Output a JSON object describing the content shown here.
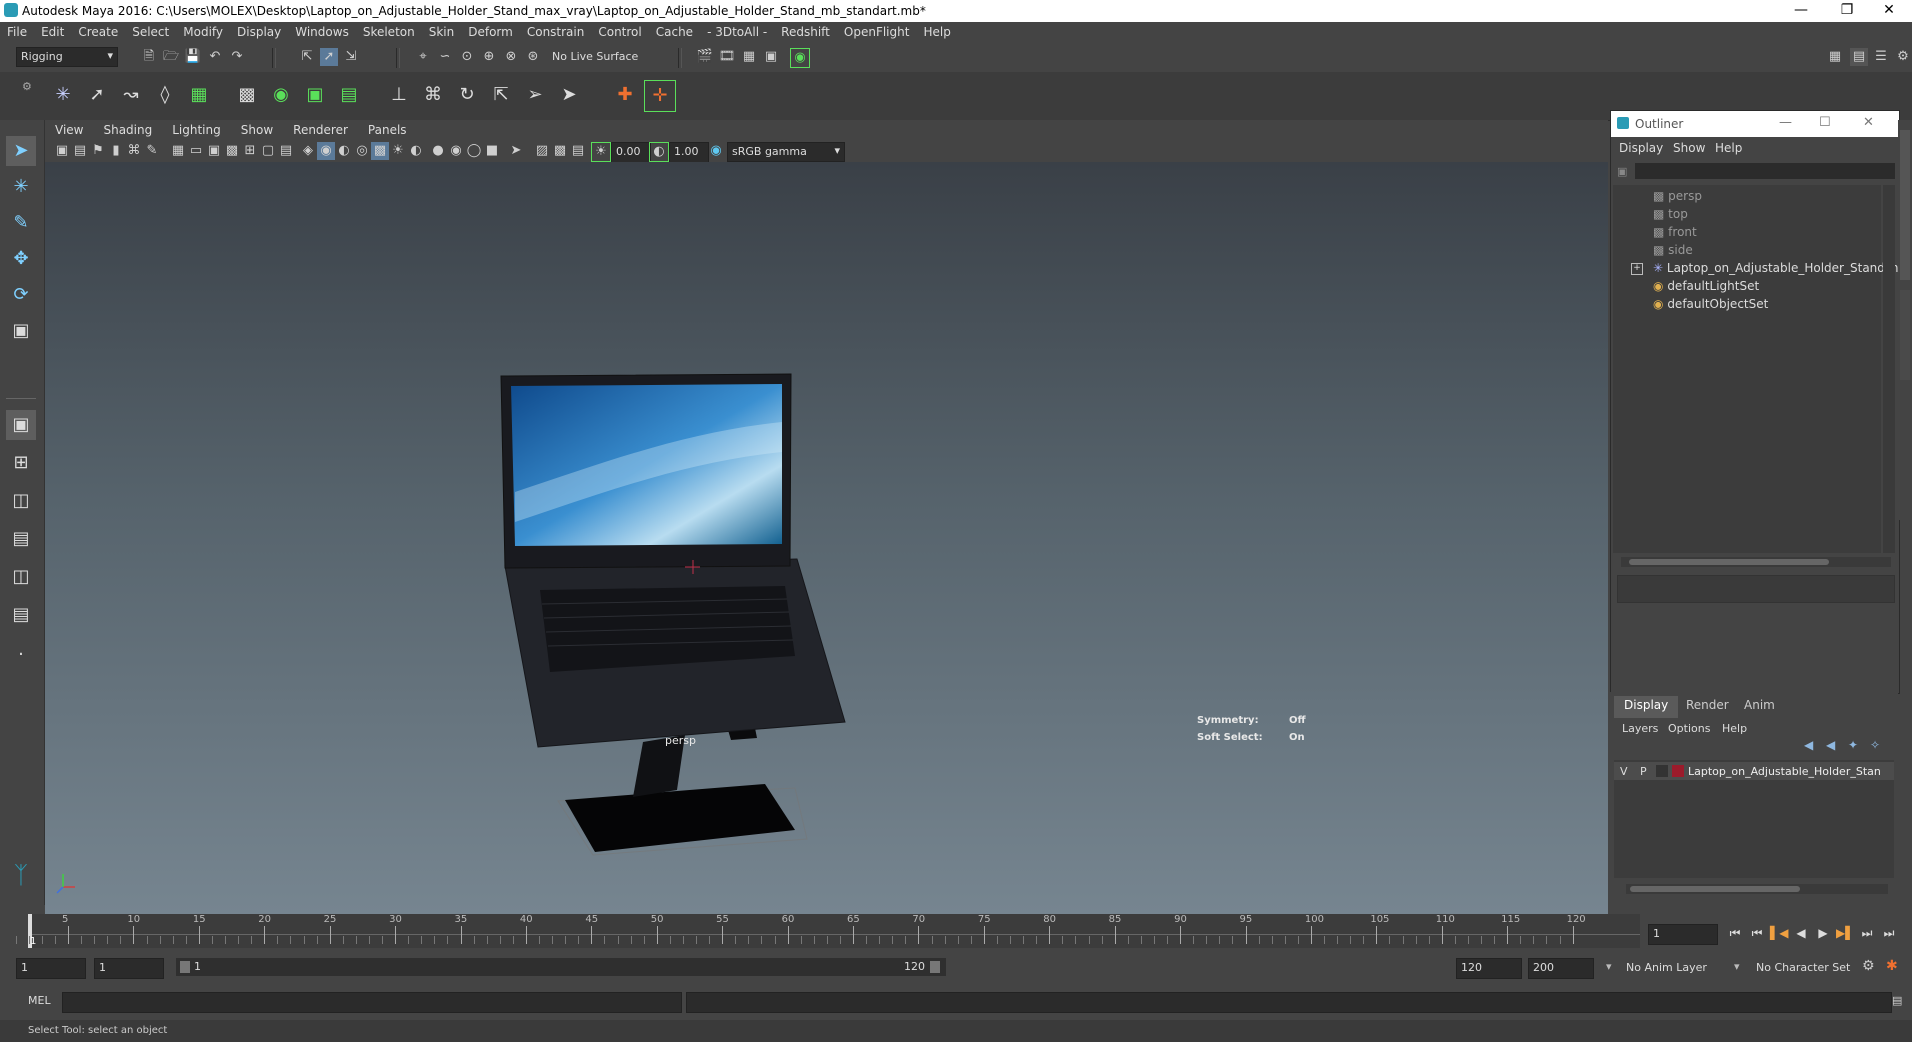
{
  "window": {
    "title": "Autodesk Maya 2016: C:\\Users\\MOLEX\\Desktop\\Laptop_on_Adjustable_Holder_Stand_max_vray\\Laptop_on_Adjustable_Holder_Stand_mb_standart.mb*"
  },
  "menubar": [
    "File",
    "Edit",
    "Create",
    "Select",
    "Modify",
    "Display",
    "Windows",
    "Skeleton",
    "Skin",
    "Deform",
    "Constrain",
    "Control",
    "Cache",
    "- 3DtoAll -",
    "Redshift",
    "OpenFlight",
    "Help"
  ],
  "shelf": {
    "mode": "Rigging",
    "live_surface": "No Live Surface"
  },
  "viewport": {
    "menus": [
      "View",
      "Shading",
      "Lighting",
      "Show",
      "Renderer",
      "Panels"
    ],
    "exposure": "0.00",
    "gamma": "1.00",
    "colorspace": "sRGB gamma",
    "camera_label": "persp",
    "symmetry_label": "Symmetry:",
    "symmetry_value": "Off",
    "softselect_label": "Soft Select:",
    "softselect_value": "On"
  },
  "outliner": {
    "title": "Outliner",
    "menus": [
      "Display",
      "Show",
      "Help"
    ],
    "items": [
      {
        "label": "persp",
        "icon": "camera-icon"
      },
      {
        "label": "top",
        "icon": "camera-icon"
      },
      {
        "label": "front",
        "icon": "camera-icon"
      },
      {
        "label": "side",
        "icon": "camera-icon"
      },
      {
        "label": "Laptop_on_Adjustable_Holder_Stand_nc",
        "icon": "group-icon"
      },
      {
        "label": "defaultLightSet",
        "icon": "set-icon"
      },
      {
        "label": "defaultObjectSet",
        "icon": "set-icon"
      }
    ]
  },
  "layers": {
    "tabs": [
      "Display",
      "Render",
      "Anim"
    ],
    "menus": [
      "Layers",
      "Options",
      "Help"
    ],
    "row": {
      "v": "V",
      "p": "P",
      "name": "Laptop_on_Adjustable_Holder_Stan",
      "color": "#9b1b2b"
    }
  },
  "timeline": {
    "ticks": [
      "5",
      "10",
      "15",
      "20",
      "25",
      "30",
      "35",
      "40",
      "45",
      "50",
      "55",
      "60",
      "65",
      "70",
      "75",
      "80",
      "85",
      "90",
      "95",
      "100",
      "105",
      "110",
      "115",
      "120"
    ],
    "start_marker": "1",
    "current_frame": "1"
  },
  "range": {
    "start": "1",
    "playback_start": "1",
    "slider_start": "1",
    "slider_end": "120",
    "playback_end": "120",
    "end": "200",
    "anim_layer": "No Anim Layer",
    "character_set": "No Character Set"
  },
  "command": {
    "lang": "MEL"
  },
  "status": {
    "help": "Select Tool: select an object"
  }
}
